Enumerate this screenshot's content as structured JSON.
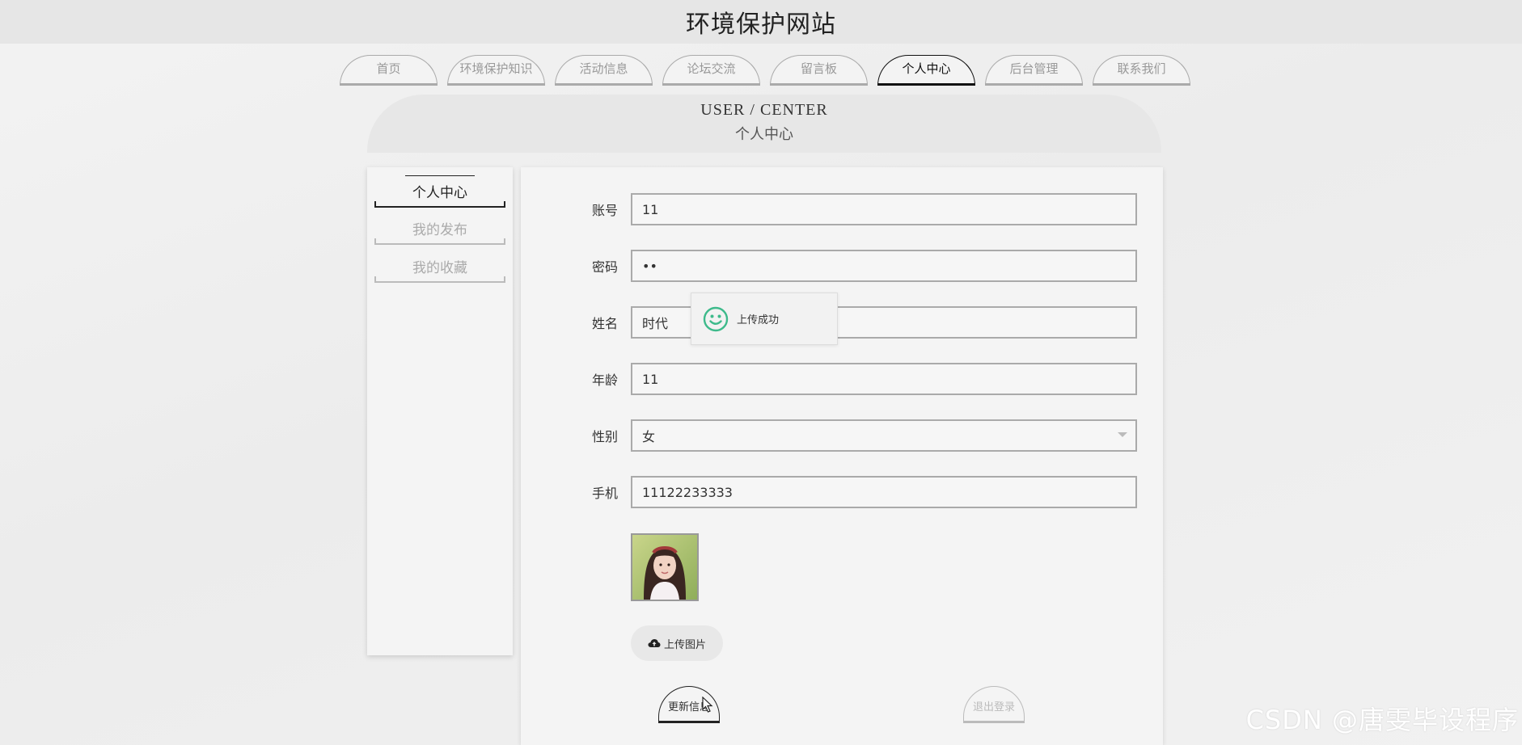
{
  "site": {
    "title": "环境保护网站"
  },
  "nav": {
    "items": [
      {
        "label": "首页",
        "active": false
      },
      {
        "label": "环境保护知识",
        "active": false
      },
      {
        "label": "活动信息",
        "active": false
      },
      {
        "label": "论坛交流",
        "active": false
      },
      {
        "label": "留言板",
        "active": false
      },
      {
        "label": "个人中心",
        "active": true
      },
      {
        "label": "后台管理",
        "active": false
      },
      {
        "label": "联系我们",
        "active": false
      }
    ]
  },
  "banner": {
    "en": "USER / CENTER",
    "cn": "个人中心"
  },
  "sidebar": {
    "items": [
      {
        "label": "个人中心",
        "active": true
      },
      {
        "label": "我的发布",
        "active": false
      },
      {
        "label": "我的收藏",
        "active": false
      }
    ]
  },
  "form": {
    "account": {
      "label": "账号",
      "value": "11"
    },
    "password": {
      "label": "密码",
      "value": "••"
    },
    "name": {
      "label": "姓名",
      "value": "时代"
    },
    "age": {
      "label": "年龄",
      "value": "11"
    },
    "gender": {
      "label": "性别",
      "value": "女"
    },
    "phone": {
      "label": "手机",
      "value": "11122233333"
    },
    "upload_label": "上传图片",
    "update_label": "更新信息",
    "logout_label": "退出登录"
  },
  "toast": {
    "text": "上传成功"
  },
  "watermark": "CSDN @唐雯毕设程序",
  "colors": {
    "accent": "#222222",
    "toast_icon": "#3dba8b",
    "panel": "#f4f4f4"
  }
}
